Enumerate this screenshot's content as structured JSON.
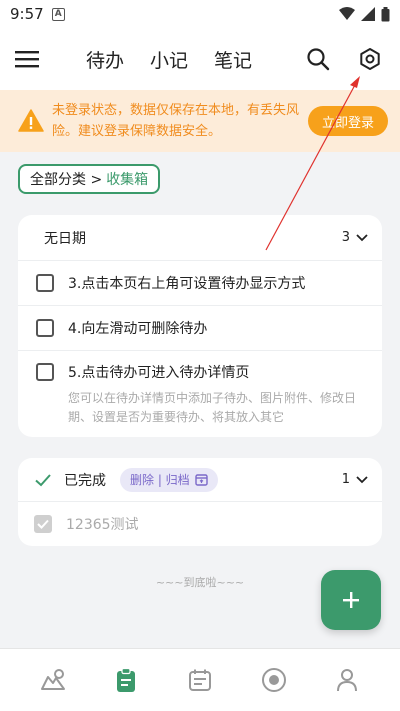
{
  "status_bar": {
    "time": "9:57",
    "badge": "A"
  },
  "header": {
    "tabs": [
      {
        "label": "待办",
        "active": true
      },
      {
        "label": "小记",
        "active": false
      },
      {
        "label": "笔记",
        "active": false
      }
    ]
  },
  "banner": {
    "message": "未登录状态，数据仅保存在本地，有丢失风险。建议登录保障数据安全。",
    "button_label": "立即登录"
  },
  "breadcrumb": {
    "root": "全部分类 >",
    "current": "收集箱"
  },
  "group": {
    "title": "无日期",
    "count": "3",
    "todos": [
      {
        "text": "3.点击本页右上角可设置待办显示方式"
      },
      {
        "text": "4.向左滑动可删除待办"
      },
      {
        "text": "5.点击待办可进入待办详情页"
      }
    ],
    "description": "您可以在待办详情页中添加子待办、图片附件、修改日期、设置是否为重要待办、将其放入其它"
  },
  "completed": {
    "title": "已完成",
    "actions": "删除 | 归档",
    "count": "1",
    "items": [
      {
        "text": "12365测试"
      }
    ]
  },
  "footer_note": "~~~到底啦~~~",
  "colors": {
    "accent": "#3c9a6c",
    "warning": "#f7a11b",
    "banner_bg": "#fdecd9",
    "arrow": "#e0322e"
  },
  "icons": {
    "menu": "menu-icon",
    "search": "search-icon",
    "settings": "settings-icon",
    "warning": "warning-icon",
    "add": "plus-icon",
    "nav": [
      "trend-icon",
      "clipboard-icon",
      "calendar-icon",
      "focus-icon",
      "profile-icon"
    ]
  }
}
